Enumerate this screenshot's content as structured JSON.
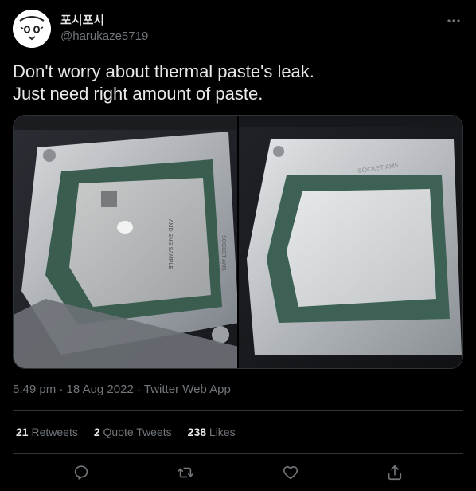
{
  "user": {
    "display_name": "포시포시",
    "handle": "@harukaze5719"
  },
  "tweet": {
    "line1": "Don't worry about thermal paste's leak.",
    "line2": "Just need right amount of paste."
  },
  "media": {
    "left_stamp": "AMD ENG SAMPLE",
    "right_stamp": "SOCKET AM5",
    "left_socket": "SOCKET AM5"
  },
  "meta": {
    "time": "5:49 pm",
    "sep1": " · ",
    "date": "18 Aug 2022",
    "sep2": " · ",
    "source": "Twitter Web App"
  },
  "stats": {
    "retweets_count": "21",
    "retweets_label": "Retweets",
    "quotes_count": "2",
    "quotes_label": "Quote Tweets",
    "likes_count": "238",
    "likes_label": "Likes"
  },
  "icons": {
    "more": "more-dots-icon",
    "reply": "reply-icon",
    "retweet": "retweet-icon",
    "like": "heart-icon",
    "share": "share-icon"
  },
  "colors": {
    "background": "#000000",
    "text": "#e7e9ea",
    "secondary": "#71767b",
    "border": "#2f3336"
  }
}
